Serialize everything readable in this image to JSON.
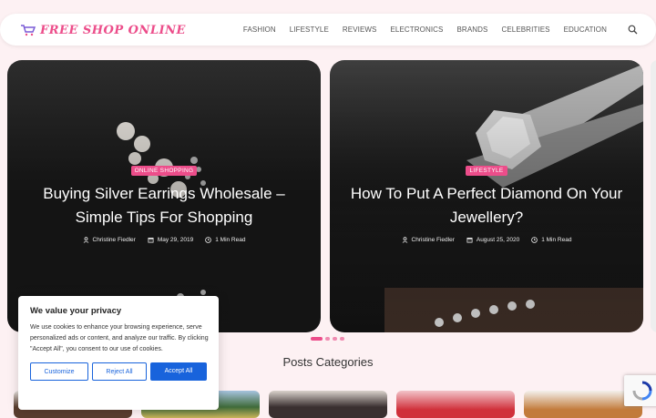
{
  "header": {
    "logo_text": "FREE SHOP ONLINE",
    "nav": [
      "FASHION",
      "LIFESTYLE",
      "REVIEWS",
      "ELECTRONICS",
      "BRANDS",
      "CELEBRITIES",
      "EDUCATION"
    ]
  },
  "slides": [
    {
      "badge": "ONLINE SHOPPING",
      "title": "Buying Silver Earrings Wholesale – Simple Tips For Shopping",
      "author": "Christine Fiedler",
      "date": "May 29, 2019",
      "read": "1 Min Read"
    },
    {
      "badge": "LIFESTYLE",
      "title": "How To Put A Perfect Diamond On Your Jewellery?",
      "author": "Christine Fiedler",
      "date": "August 25, 2020",
      "read": "1 Min Read"
    }
  ],
  "slider": {
    "total": 4,
    "active": 1
  },
  "section": {
    "title": "Posts Categories"
  },
  "cookie": {
    "title": "We value your privacy",
    "text": "We use cookies to enhance your browsing experience, serve personalized ads or content, and analyze our traffic. By clicking \"Accept All\", you consent to our use of cookies.",
    "customize": "Customize",
    "reject": "Reject All",
    "accept": "Accept All"
  },
  "colors": {
    "accent": "#ec4d8a",
    "button": "#1863dc",
    "background": "#fdf1f3"
  }
}
